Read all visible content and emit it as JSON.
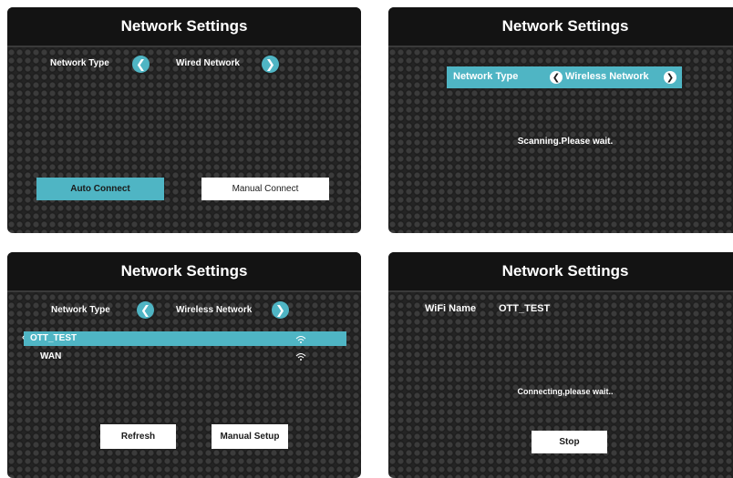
{
  "panel1": {
    "title": "Network Settings",
    "network_type_label": "Network Type",
    "network_type_value": "Wired Network",
    "left_arrow_icon": "chevron-left-icon",
    "right_arrow_icon": "chevron-right-icon",
    "auto_connect_label": "Auto Connect",
    "manual_connect_label": "Manual Connect"
  },
  "panel2": {
    "title": "Network Settings",
    "network_type_label": "Network Type",
    "network_type_value": "Wireless Network",
    "status_text": "Scanning.Please wait."
  },
  "panel3": {
    "title": "Network Settings",
    "network_type_label": "Network Type",
    "network_type_value": "Wireless Network",
    "networks": [
      {
        "name": "OTT_TEST",
        "selected": true,
        "icon": "wifi-signal-icon"
      },
      {
        "name": "WAN",
        "selected": false,
        "icon": "wifi-signal-icon"
      }
    ],
    "refresh_label": "Refresh",
    "manual_setup_label": "Manual Setup"
  },
  "panel4": {
    "title": "Network Settings",
    "wifi_name_label": "WiFi Name",
    "wifi_name_value": "OTT_TEST",
    "status_text": "Connecting,please wait..",
    "stop_label": "Stop"
  },
  "colors": {
    "accent": "#4fb5c4",
    "panel_bg": "#2a2a2a",
    "title_bg": "#131313"
  }
}
